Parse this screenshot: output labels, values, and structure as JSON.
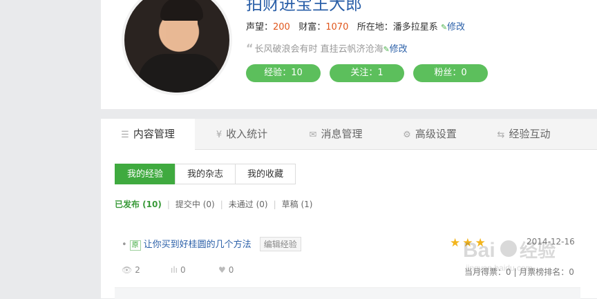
{
  "profile": {
    "username": "拍财进宝王大郎",
    "reputation_label": "声望：",
    "reputation_value": "200",
    "wealth_label": "财富：",
    "wealth_value": "1070",
    "location_label": "所在地：",
    "location_value": "潘多拉星系",
    "edit_label": "修改",
    "motto": "长风破浪会有时 直挂云帆济沧海",
    "motto_edit_label": "修改",
    "quote_mark": "“",
    "pills": {
      "experience": "经验：10",
      "following": "关注：1",
      "fans": "粉丝：0"
    }
  },
  "tabs": [
    {
      "label": "内容管理",
      "icon": "list-icon",
      "glyph": "☰",
      "active": true
    },
    {
      "label": "收入统计",
      "icon": "yen-icon",
      "glyph": "¥",
      "active": false
    },
    {
      "label": "消息管理",
      "icon": "mail-icon",
      "glyph": "✉",
      "active": false
    },
    {
      "label": "高级设置",
      "icon": "gear-icon",
      "glyph": "⚙",
      "active": false
    },
    {
      "label": "经验互动",
      "icon": "exchange-icon",
      "glyph": "⇆",
      "active": false
    }
  ],
  "subtabs": [
    "我的经验",
    "我的杂志",
    "我的收藏"
  ],
  "filters": {
    "published": "已发布 (10)",
    "submitting": "提交中 (0)",
    "rejected": "未通过 (0)",
    "draft": "草稿 (1)",
    "separator": "|"
  },
  "article": {
    "bullet": "•",
    "badge": "原",
    "title": "让你买到好桂圆的几个方法",
    "edit_tag": "编辑经验",
    "stars": "★★★",
    "date": "2014-12-16",
    "views": "2",
    "votes": "0",
    "likes": "0",
    "rank_text": "当月得票：0 | 月票榜排名：0"
  },
  "watermark": {
    "brand": "Bai",
    "brand_suffix": "经验",
    "url": "jingyan.baidu.com"
  },
  "colors": {
    "accent_green": "#3faa3f",
    "pill_green": "#5cbf5c",
    "link_blue": "#2a5fa8",
    "highlight_orange": "#e0561c",
    "star_gold": "#f3b51d"
  }
}
